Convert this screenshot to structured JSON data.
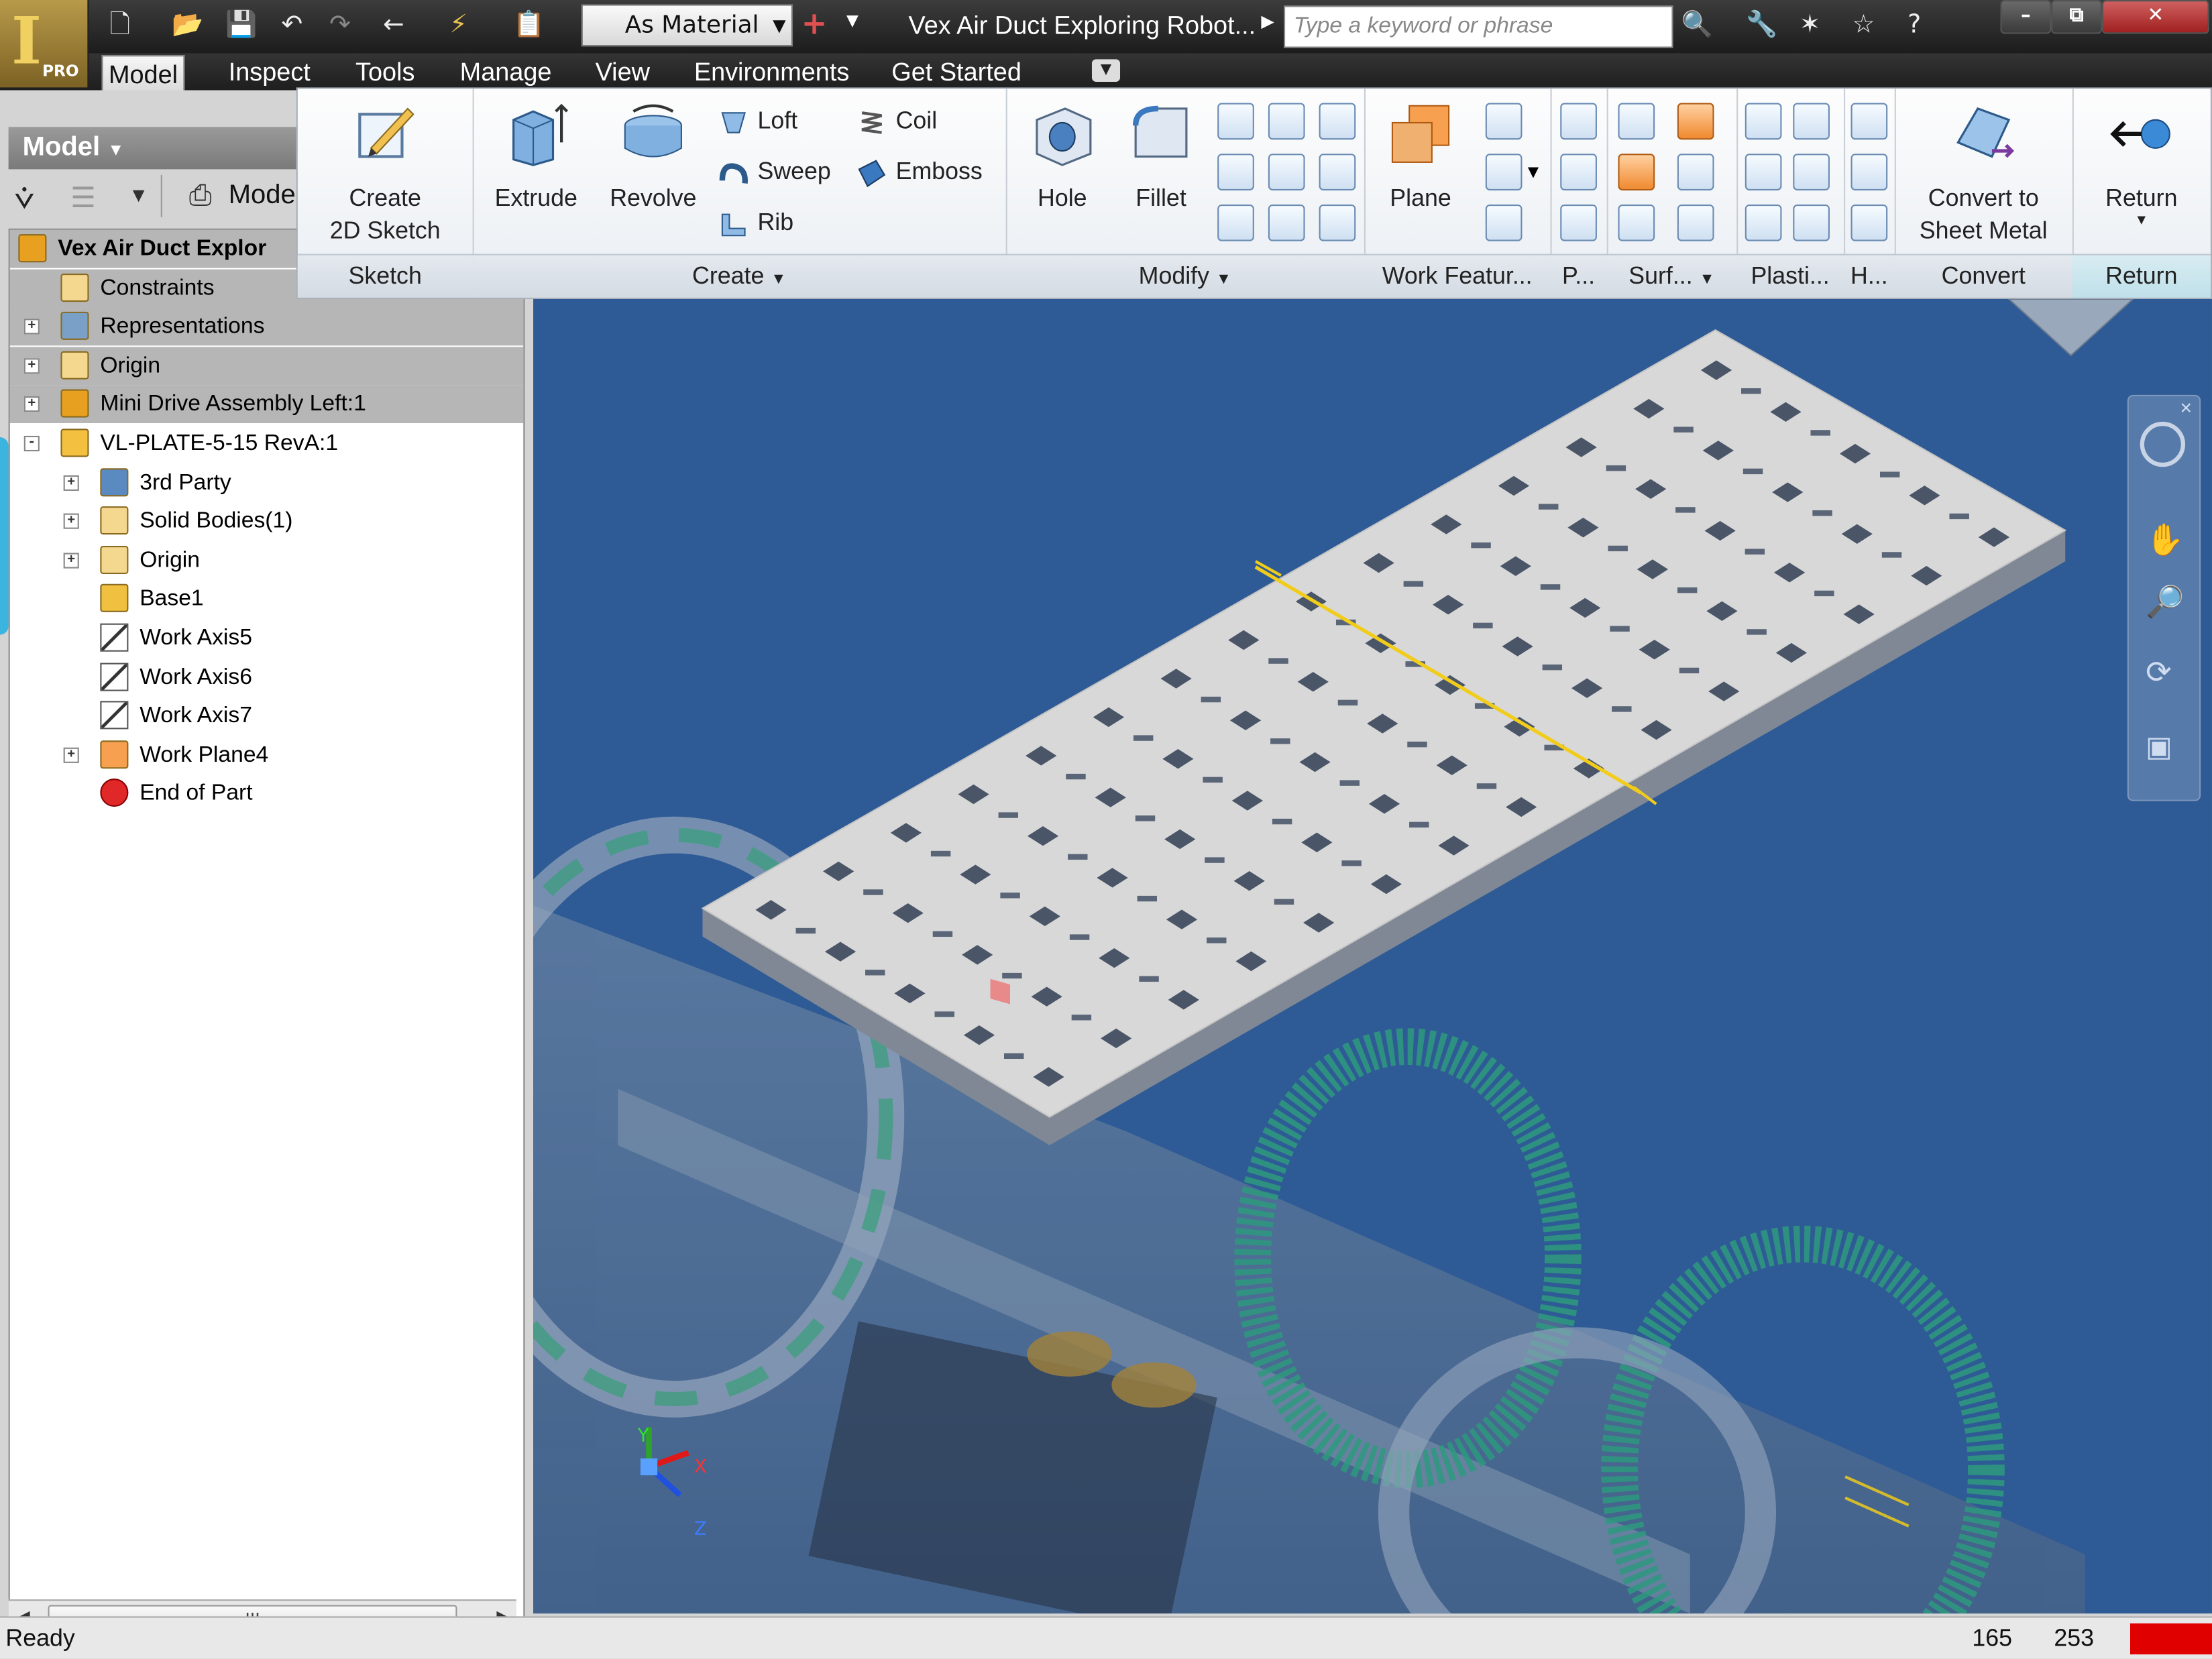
{
  "app": {
    "logo_letter": "I",
    "logo_badge": "PRO"
  },
  "quick_access": {
    "appearance_value": "As Material",
    "document_title": "Vex Air Duct Exploring Robot...",
    "search_placeholder": "Type a keyword or phrase"
  },
  "window_controls": {
    "minimize": "–",
    "restore": "⧉",
    "close": "✕"
  },
  "menu_tabs": [
    "Model",
    "Inspect",
    "Tools",
    "Manage",
    "View",
    "Environments",
    "Get Started"
  ],
  "ribbon": {
    "sketch": {
      "title": "Sketch",
      "create_2d_sketch_line1": "Create",
      "create_2d_sketch_line2": "2D Sketch"
    },
    "create": {
      "title": "Create",
      "extrude": "Extrude",
      "revolve": "Revolve",
      "loft": "Loft",
      "sweep": "Sweep",
      "rib": "Rib",
      "coil": "Coil",
      "emboss": "Emboss"
    },
    "modify": {
      "title": "Modify",
      "hole": "Hole",
      "fillet": "Fillet"
    },
    "work_features": {
      "title": "Work Featur...",
      "plane": "Plane"
    },
    "pattern": {
      "title": "P..."
    },
    "surface": {
      "title": "Surf..."
    },
    "plastic": {
      "title": "Plasti..."
    },
    "harness": {
      "title": "H..."
    },
    "convert": {
      "title": "Convert",
      "line1": "Convert to",
      "line2": "Sheet Metal"
    },
    "return": {
      "title": "Return",
      "label": "Return"
    }
  },
  "browser": {
    "header": "Model",
    "toolbar_label": "Mode",
    "tree": [
      {
        "label": "Vex Air Duct Explor",
        "level": 0,
        "expander": "",
        "icon": "assembly-icon",
        "gray": true,
        "bold": true
      },
      {
        "label": "Constraints",
        "level": 1,
        "expander": "",
        "icon": "folder-icon",
        "gray": true
      },
      {
        "label": "Representations",
        "level": 1,
        "expander": "+",
        "icon": "representations-icon",
        "gray": true
      },
      {
        "label": "Origin",
        "level": 1,
        "expander": "+",
        "icon": "folder-icon",
        "gray": true
      },
      {
        "label": "Mini Drive Assembly Left:1",
        "level": 1,
        "expander": "+",
        "icon": "assembly-icon",
        "gray": true
      },
      {
        "label": "VL-PLATE-5-15 RevA:1",
        "level": 1,
        "expander": "-",
        "icon": "part-icon",
        "gray": false
      },
      {
        "label": "3rd Party",
        "level": 2,
        "expander": "+",
        "icon": "third-party-icon",
        "gray": false
      },
      {
        "label": "Solid Bodies(1)",
        "level": 2,
        "expander": "+",
        "icon": "solid-bodies-icon",
        "gray": false
      },
      {
        "label": "Origin",
        "level": 2,
        "expander": "+",
        "icon": "folder-icon",
        "gray": false
      },
      {
        "label": "Base1",
        "level": 2,
        "expander": "",
        "icon": "base-feature-icon",
        "gray": false
      },
      {
        "label": "Work Axis5",
        "level": 2,
        "expander": "",
        "icon": "work-axis-icon",
        "gray": false
      },
      {
        "label": "Work Axis6",
        "level": 2,
        "expander": "",
        "icon": "work-axis-icon",
        "gray": false
      },
      {
        "label": "Work Axis7",
        "level": 2,
        "expander": "",
        "icon": "work-axis-icon",
        "gray": false
      },
      {
        "label": "Work Plane4",
        "level": 2,
        "expander": "+",
        "icon": "work-plane-icon",
        "gray": false
      },
      {
        "label": "End of Part",
        "level": 2,
        "expander": "",
        "icon": "end-of-part-icon",
        "gray": false
      }
    ],
    "scroll_thumb": "III"
  },
  "triad": {
    "x": "X",
    "y": "Y",
    "z": "Z"
  },
  "status": {
    "text": "Ready",
    "value1": "165",
    "value2": "253"
  },
  "colors": {
    "viewport_bg": "#2e5b95",
    "plate": "#d8d8d8",
    "gear": "#2ea57a",
    "work_axis": "#f2cc1a",
    "status_indicator": "#e00000"
  }
}
